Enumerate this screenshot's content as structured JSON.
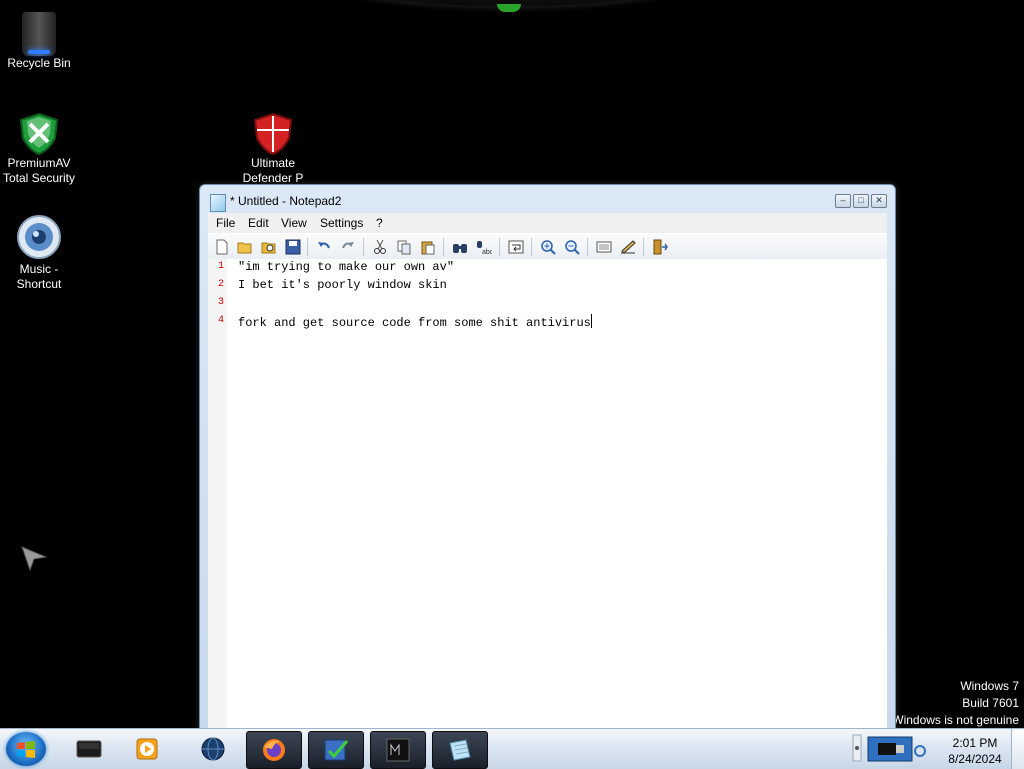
{
  "desktop": {
    "icons": [
      {
        "label": "Recycle Bin",
        "icon": "recycle-bin-icon"
      },
      {
        "label": "PremiumAV Total Security",
        "icon": "shield-check-icon"
      },
      {
        "label": "Music - Shortcut",
        "icon": "speaker-icon"
      },
      {
        "label": "Ultimate Defender P",
        "icon": "shield-red-icon"
      }
    ],
    "watermark": [
      "Windows 7",
      "Build 7601",
      "Windows is not genuine"
    ]
  },
  "window": {
    "title": "* Untitled - Notepad2",
    "controls": [
      "minimize",
      "maximize",
      "close"
    ],
    "menu": [
      "File",
      "Edit",
      "View",
      "Settings",
      "?"
    ],
    "toolbar": [
      "new-icon",
      "open-icon",
      "browse-icon",
      "save-icon",
      "undo-icon",
      "redo-icon",
      "cut-icon",
      "copy-icon",
      "paste-icon",
      "find-icon",
      "replace-icon",
      "word-wrap-icon",
      "zoom-in-icon",
      "zoom-out-icon",
      "schemes-icon",
      "customize-icon",
      "exit-icon"
    ],
    "lines": [
      {
        "num": "1",
        "text": "\"im trying to make our own av\""
      },
      {
        "num": "2",
        "text": "I bet it's poorly window skin"
      },
      {
        "num": "3",
        "text": ""
      },
      {
        "num": "4",
        "text": "fork and get source code from some shit antivirus"
      }
    ]
  },
  "taskbar": {
    "apps": [
      "terminal-app-icon",
      "media-player-icon",
      "ie-globe-icon",
      "firefox-icon",
      "task-check-icon",
      "monitor-app-icon",
      "notepad2-icon"
    ],
    "clock": {
      "time": "2:01 PM",
      "date": "8/24/2024"
    }
  }
}
